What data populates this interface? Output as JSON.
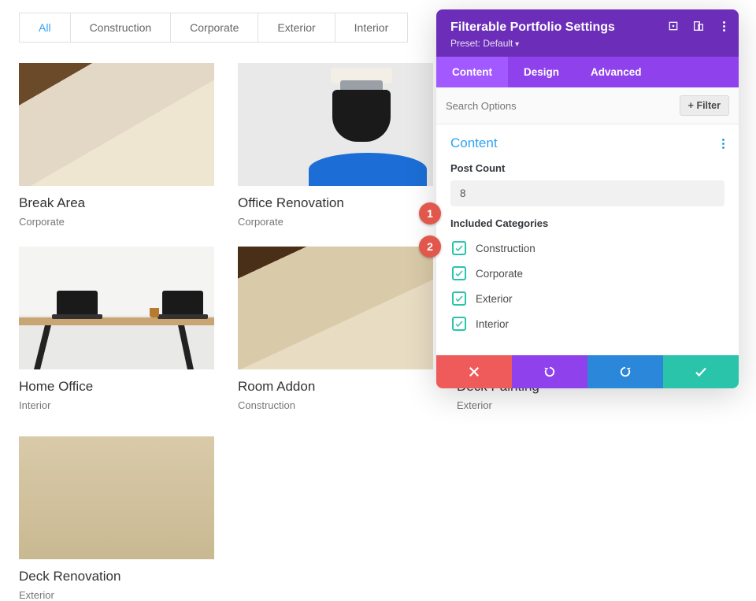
{
  "filters": {
    "all": "All",
    "construction": "Construction",
    "corporate": "Corporate",
    "exterior": "Exterior",
    "interior": "Interior"
  },
  "cards": {
    "break": {
      "title": "Break Area",
      "cat": "Corporate"
    },
    "office": {
      "title": "Office Renovation",
      "cat": "Corporate"
    },
    "home": {
      "title": "Home Office",
      "cat": "Interior"
    },
    "addon": {
      "title": "Room Addon",
      "cat": "Construction"
    },
    "deckp": {
      "title": "Deck Painting",
      "cat": "Exterior"
    },
    "deckr": {
      "title": "Deck Renovation",
      "cat": "Exterior"
    }
  },
  "panel": {
    "title": "Filterable Portfolio Settings",
    "preset": "Preset: Default",
    "tabs": {
      "content": "Content",
      "design": "Design",
      "advanced": "Advanced"
    },
    "search_placeholder": "Search Options",
    "filter_btn": "Filter",
    "section_title": "Content",
    "post_count_label": "Post Count",
    "post_count_value": "8",
    "included_label": "Included Categories",
    "categories": {
      "construction": "Construction",
      "corporate": "Corporate",
      "exterior": "Exterior",
      "interior": "Interior"
    }
  },
  "anno": {
    "one": "1",
    "two": "2"
  }
}
